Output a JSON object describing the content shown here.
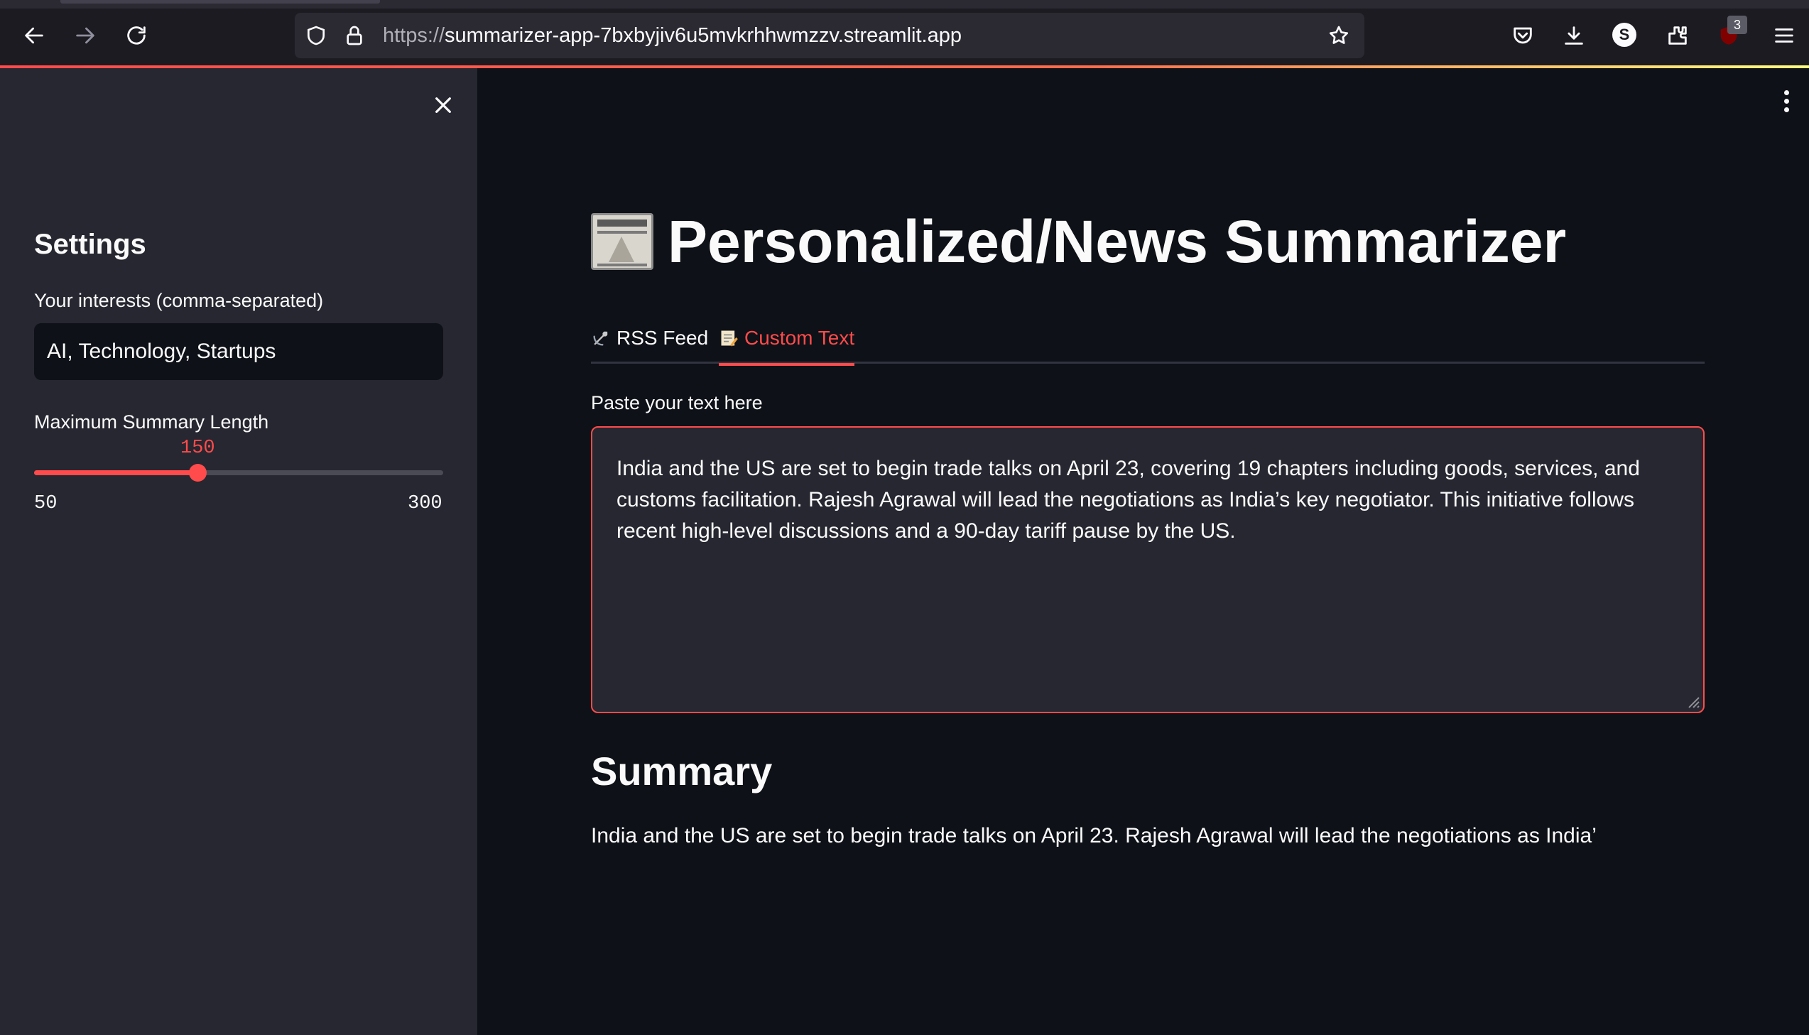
{
  "browser": {
    "url_scheme": "https://",
    "url_host": "summarizer-app-7bxbyjiv6u5mvkrhhwmzzv.streamlit.app",
    "profile_initial": "S",
    "extension_badge": "3",
    "icons": [
      "back-arrow-icon",
      "forward-arrow-icon",
      "reload-icon",
      "shield-icon",
      "lock-icon",
      "star-icon",
      "pocket-icon",
      "download-icon",
      "extensions-icon",
      "ublock-icon",
      "hamburger-menu-icon"
    ]
  },
  "sidebar": {
    "title": "Settings",
    "interests_label": "Your interests (comma-separated)",
    "interests_value": "AI, Technology, Startups",
    "length_label": "Maximum Summary Length",
    "length_value": "150",
    "length_min": "50",
    "length_max": "300",
    "length_fraction": 0.4
  },
  "main": {
    "title": "Personalized/News Summarizer",
    "tabs": [
      {
        "icon": "satellite-antenna-icon",
        "label": "RSS Feed",
        "active": false
      },
      {
        "icon": "memo-icon",
        "label": "Custom Text",
        "active": true
      }
    ],
    "textarea_label": "Paste your text here",
    "textarea_value": "India and the US are set to begin trade talks on April 23, covering 19 chapters including goods, services, and customs facilitation. Rajesh Agrawal will lead the negotiations as India’s key negotiator. This initiative follows recent high-level discussions and a 90-day tariff pause by the US.",
    "summary_heading": "Summary",
    "summary_text": "India and the US are set to begin trade talks on April 23. Rajesh Agrawal will lead the negotiations as India’"
  },
  "colors": {
    "accent": "#ff4b4b",
    "background": "#0e1117",
    "sidebar": "#262730"
  }
}
